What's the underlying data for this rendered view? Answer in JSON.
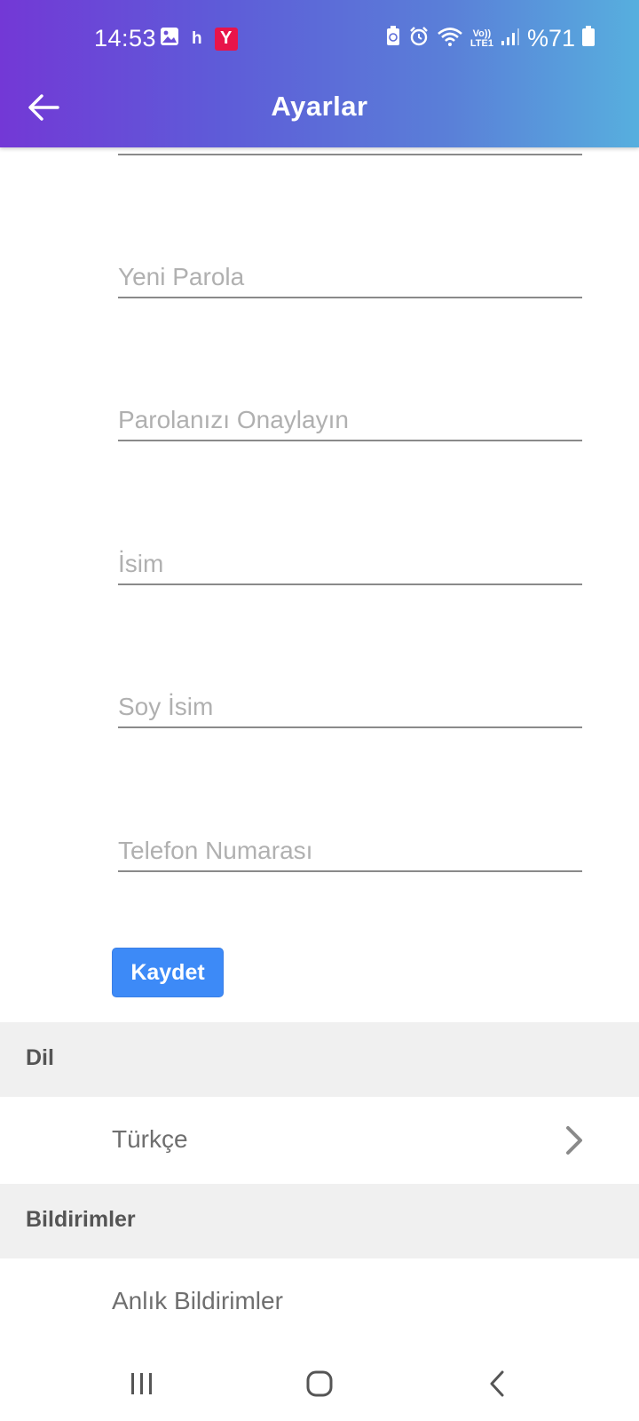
{
  "status_bar": {
    "time": "14:53",
    "notification_letter": "h",
    "notification_app_letter": "Y",
    "network_label_top": "Vo))",
    "network_label_bottom": "LTE1",
    "battery": "%71",
    "accent_y_color": "#e8144a"
  },
  "app_bar": {
    "title": "Ayarlar",
    "back_icon": "arrow-left-icon",
    "gradient": [
      "#7338d6",
      "#57afde"
    ]
  },
  "form": {
    "fields": [
      {
        "placeholder": "Yeni Parola",
        "value": ""
      },
      {
        "placeholder": "Parolanızı Onaylayın",
        "value": ""
      },
      {
        "placeholder": "İsim",
        "value": ""
      },
      {
        "placeholder": "Soy İsim",
        "value": ""
      },
      {
        "placeholder": "Telefon Numarası",
        "value": ""
      }
    ],
    "save_label": "Kaydet",
    "save_color": "#3d8af7"
  },
  "language_section": {
    "header": "Dil",
    "selected": "Türkçe"
  },
  "notifications_section": {
    "header": "Bildirimler",
    "item": "Anlık Bildirimler"
  },
  "nav_bar": {
    "recents_icon": "recents-icon",
    "home_icon": "home-icon",
    "back_icon": "back-chevron-icon"
  }
}
